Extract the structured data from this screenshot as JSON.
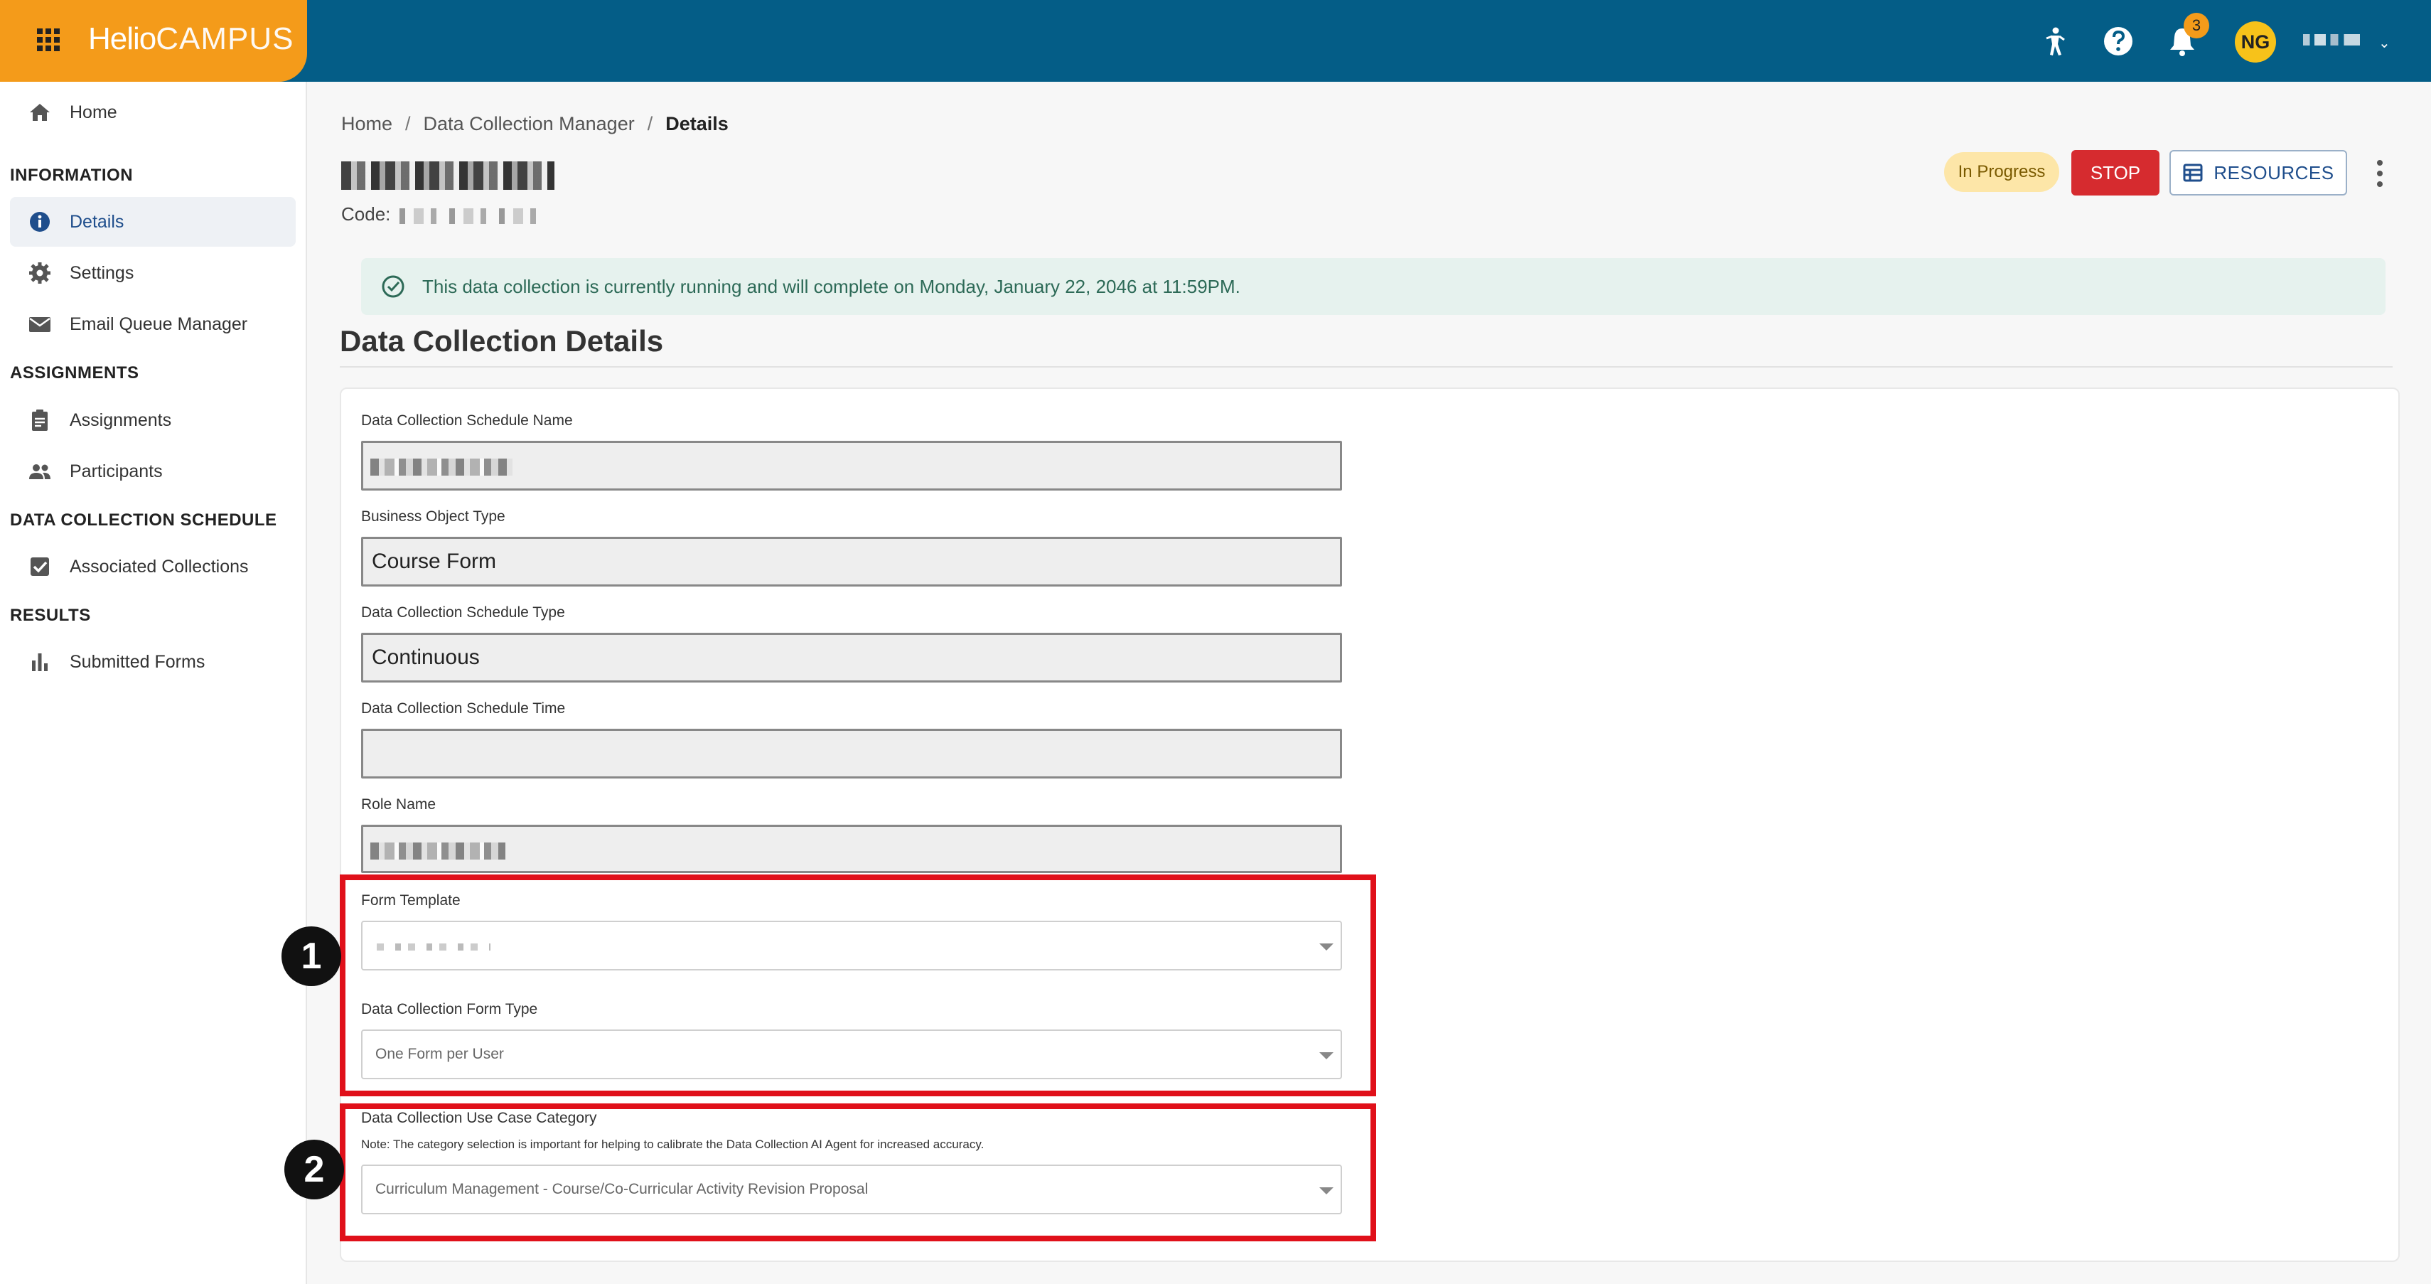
{
  "app": {
    "brand_bold": "Helio",
    "brand_light": "CAMPUS",
    "notification_count": "3",
    "user_initials": "NG"
  },
  "sidebar": {
    "home": "Home",
    "sections": [
      {
        "title": "INFORMATION",
        "items": [
          "Details",
          "Settings",
          "Email Queue Manager"
        ]
      },
      {
        "title": "ASSIGNMENTS",
        "items": [
          "Assignments",
          "Participants"
        ]
      },
      {
        "title": "DATA COLLECTION SCHEDULE",
        "items": [
          "Associated Collections"
        ]
      },
      {
        "title": "RESULTS",
        "items": [
          "Submitted Forms"
        ]
      }
    ],
    "active_item": "Details"
  },
  "breadcrumb": [
    "Home",
    "Data Collection Manager",
    "Details"
  ],
  "header": {
    "code_label": "Code:",
    "status": "In Progress",
    "stop_label": "STOP",
    "resources_label": "RESOURCES"
  },
  "alert": {
    "text": "This data collection is currently running and will complete on Monday, January 22, 2046 at 11:59PM."
  },
  "details": {
    "heading": "Data Collection Details",
    "fields": {
      "schedule_name_label": "Data Collection Schedule Name",
      "business_object_type_label": "Business Object Type",
      "business_object_type_value": "Course Form",
      "schedule_type_label": "Data Collection Schedule Type",
      "schedule_type_value": "Continuous",
      "schedule_time_label": "Data Collection Schedule Time",
      "schedule_time_value": "",
      "role_name_label": "Role Name",
      "form_template_label": "Form Template",
      "form_type_label": "Data Collection Form Type",
      "form_type_value": "One Form per User",
      "use_case_label": "Data Collection Use Case Category",
      "use_case_note": "Note: The category selection is important for helping to calibrate the Data Collection AI Agent for increased accuracy.",
      "use_case_value": "Curriculum Management - Course/Co-Curricular Activity Revision Proposal"
    }
  },
  "annotations": {
    "marker_1": "1",
    "marker_2": "2",
    "highlight_color": "#e0101a"
  }
}
